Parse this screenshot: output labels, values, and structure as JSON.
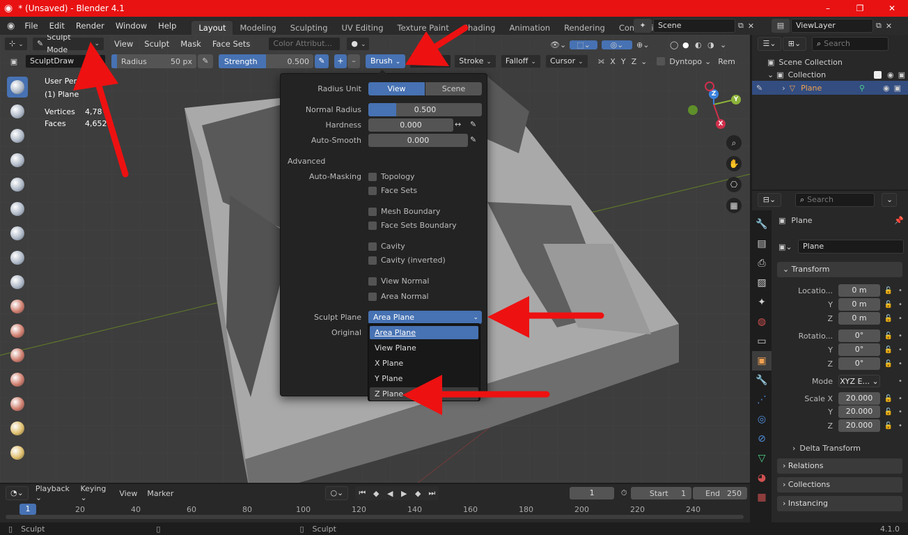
{
  "window": {
    "title": "* (Unsaved) - Blender 4.1",
    "minimize": "–",
    "maximize": "❐",
    "close": "✕"
  },
  "menu": {
    "items": [
      "File",
      "Edit",
      "Render",
      "Window",
      "Help"
    ]
  },
  "workspaces": [
    "Layout",
    "Modeling",
    "Sculpting",
    "UV Editing",
    "Texture Paint",
    "Shading",
    "Animation",
    "Rendering",
    "Compositing"
  ],
  "scene": {
    "name": "Scene",
    "view_layer": "ViewLayer"
  },
  "header": {
    "mode": "Sculpt Mode",
    "menus": [
      "View",
      "Sculpt",
      "Mask",
      "Face Sets"
    ],
    "color_attr": "Color Attribut..."
  },
  "tool_settings": {
    "brush_name": "SculptDraw",
    "radius_label": "Radius",
    "radius_value": "50 px",
    "strength_label": "Strength",
    "strength_value": "0.500",
    "plus": "+",
    "minus": "–",
    "brush_menu": "Brush",
    "stroke_menu": "Stroke",
    "falloff_menu": "Falloff",
    "cursor_menu": "Cursor",
    "axes": [
      "X",
      "Y",
      "Z"
    ],
    "dyntopo": "Dyntopo",
    "remesh": "Rem"
  },
  "viewport": {
    "info_title": "User Persp",
    "object": "(1) Plane",
    "vertices_label": "Vertices",
    "vertices_value": "4,78",
    "faces_label": "Faces",
    "faces_value": "4,652"
  },
  "brush_popover": {
    "radius_unit_label": "Radius Unit",
    "radius_unit_options": [
      "View",
      "Scene"
    ],
    "normal_radius_label": "Normal Radius",
    "normal_radius_value": "0.500",
    "hardness_label": "Hardness",
    "hardness_value": "0.000",
    "auto_smooth_label": "Auto-Smooth",
    "auto_smooth_value": "0.000",
    "advanced": "Advanced",
    "auto_masking_label": "Auto-Masking",
    "masking_options": [
      "Topology",
      "Face Sets",
      "Mesh Boundary",
      "Face Sets Boundary",
      "Cavity",
      "Cavity (inverted)",
      "View Normal",
      "Area Normal"
    ],
    "sculpt_plane_label": "Sculpt Plane",
    "sculpt_plane_value": "Area Plane",
    "original_label": "Original"
  },
  "sculpt_plane_dropdown": [
    {
      "label": "Area Plane",
      "state": "selected"
    },
    {
      "label": "View Plane",
      "state": ""
    },
    {
      "label": "X Plane",
      "state": ""
    },
    {
      "label": "Y Plane",
      "state": ""
    },
    {
      "label": "Z Plane",
      "state": "hover"
    }
  ],
  "outliner": {
    "search_placeholder": "Search",
    "scene_collection": "Scene Collection",
    "collection": "Collection",
    "object": "Plane"
  },
  "properties": {
    "search_placeholder": "Search",
    "object_name": "Plane",
    "datablock": "Plane",
    "transform": "Transform",
    "location_label": "Locatio...",
    "location": [
      "0 m",
      "0 m",
      "0 m"
    ],
    "rotation_label": "Rotatio...",
    "rotation": [
      "0°",
      "0°",
      "0°"
    ],
    "mode_label": "Mode",
    "mode_value": "XYZ E...",
    "scale_label": "Scale X",
    "scale": [
      "20.000",
      "20.000",
      "20.000"
    ],
    "axis_y": "Y",
    "axis_z": "Z",
    "delta_transform": "Delta Transform",
    "sections": [
      "Relations",
      "Collections",
      "Instancing"
    ]
  },
  "timeline": {
    "menus": [
      "Playback",
      "Keying",
      "View",
      "Marker"
    ],
    "current_frame": "1",
    "start_label": "Start",
    "start_value": "1",
    "end_label": "End",
    "end_value": "250",
    "ticks": [
      "20",
      "40",
      "60",
      "80",
      "100",
      "120",
      "140",
      "160",
      "180",
      "200",
      "220",
      "240"
    ],
    "current_tick": "1"
  },
  "statusbar": {
    "left": "Sculpt",
    "middle": "Sculpt",
    "version": "4.1.0"
  },
  "colors": {
    "accent": "#4772b3",
    "titlebar": "#e81212",
    "arrow": "#ee1111"
  }
}
